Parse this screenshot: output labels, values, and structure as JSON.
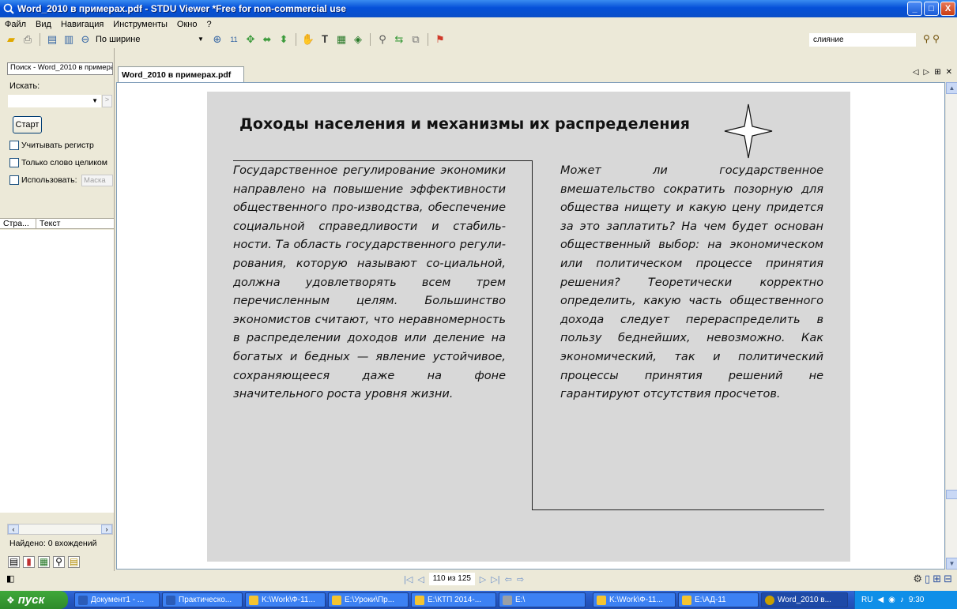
{
  "window": {
    "title": "Word_2010 в примерах.pdf - STDU Viewer *Free for non-commercial use",
    "minimize": "_",
    "maximize": "□",
    "close": "X"
  },
  "menu": [
    "Файл",
    "Вид",
    "Навигация",
    "Инструменты",
    "Окно",
    "?"
  ],
  "toolbar": {
    "zoom_value": "По ширине",
    "zoom_percent_label": "11",
    "search_value": "слияние"
  },
  "sidebar": {
    "tab_label": "Поиск - Word_2010 в примерах",
    "search_label": "Искать:",
    "search_value": "",
    "start_button": "Старт",
    "case_label": "Учитывать регистр",
    "whole_word_label": "Только слово целиком",
    "use_label": "Использовать:",
    "mask_label": "Маска",
    "col_page": "Стра...",
    "col_text": "Текст",
    "found": "Найдено: 0 вхождений"
  },
  "tab": {
    "label": "Word_2010 в примерах.pdf"
  },
  "document": {
    "title": "Доходы населения и механизмы их распределения",
    "left_column": "Государственное регулирование экономики направлено на повышение эффективности общественного про-изводства, обеспечение социальной справедливости и стабиль-ности. Та область государственного регули-рования, которую называют со-циальной, должна удовлетворять всем трем перечисленным целям. Большинство экономистов считают, что неравномерность в распределении доходов или деление на богатых и бедных — явление устойчивое, сохраняющееся даже на фоне значительного роста уровня жизни.",
    "right_column": "Может ли государственное вмешательство сократить позорную для общества нищету и какую цену придется за это заплатить? На чем будет основан общественный выбор: на экономическом или политическом процессе принятия решения? Теоретически корректно определить, какую часть общественного дохода следует перераспределить в пользу беднейших, невозможно. Как экономический, так и политический процессы принятия решений не гарантируют отсутствия просчетов."
  },
  "navigation": {
    "page_indicator": "110 из 125"
  },
  "taskbar": {
    "start": "пуск",
    "tasks": [
      {
        "label": "Документ1 - ...",
        "color": "#2B5CB8"
      },
      {
        "label": "Практическо...",
        "color": "#2B5CB8"
      },
      {
        "label": "K:\\Work\\Ф-11...",
        "color": "#F4C431"
      },
      {
        "label": "E:\\Уроки\\Пр...",
        "color": "#F4C431"
      },
      {
        "label": "E:\\КТП 2014-...",
        "color": "#F4C431"
      },
      {
        "label": "E:\\",
        "color": "#9aa0a6"
      },
      {
        "label": "K:\\Work\\Ф-11...",
        "color": "#F4C431"
      },
      {
        "label": "E:\\АД-11",
        "color": "#F4C431"
      },
      {
        "label": "Word_2010 в...",
        "color": "#C8A000"
      }
    ],
    "lang": "RU",
    "clock": "9:30"
  }
}
